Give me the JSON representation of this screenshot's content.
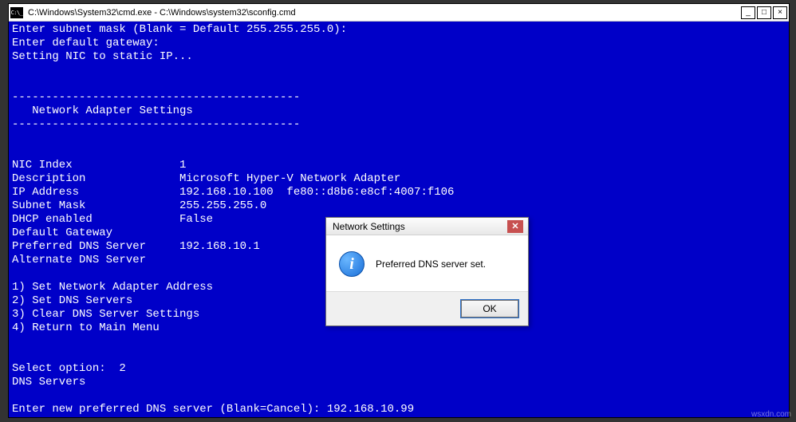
{
  "window": {
    "title": "C:\\Windows\\System32\\cmd.exe - C:\\Windows\\system32\\sconfig.cmd",
    "icon_label": "C:\\_",
    "min_label": "_",
    "max_label": "□",
    "close_label": "×"
  },
  "console": {
    "prompt_subnet": "Enter subnet mask (Blank = Default 255.255.255.0):",
    "prompt_gateway": "Enter default gateway:",
    "status_setting": "Setting NIC to static IP...",
    "rule": "-------------------------------------------",
    "section_title": "   Network Adapter Settings",
    "fields": {
      "nic_index": {
        "label": "NIC Index",
        "value": "1"
      },
      "description": {
        "label": "Description",
        "value": "Microsoft Hyper-V Network Adapter"
      },
      "ip_address": {
        "label": "IP Address",
        "value": "192.168.10.100  fe80::d8b6:e8cf:4007:f106"
      },
      "subnet_mask": {
        "label": "Subnet Mask",
        "value": "255.255.255.0"
      },
      "dhcp": {
        "label": "DHCP enabled",
        "value": "False"
      },
      "gateway": {
        "label": "Default Gateway",
        "value": ""
      },
      "pref_dns": {
        "label": "Preferred DNS Server",
        "value": "192.168.10.1"
      },
      "alt_dns": {
        "label": "Alternate DNS Server",
        "value": ""
      }
    },
    "menu": {
      "item1": "1) Set Network Adapter Address",
      "item2": "2) Set DNS Servers",
      "item3": "3) Clear DNS Server Settings",
      "item4": "4) Return to Main Menu"
    },
    "select_label": "Select option:  ",
    "select_value": "2",
    "dns_heading": "DNS Servers",
    "prompt_newdns_label": "Enter new preferred DNS server (Blank=Cancel): ",
    "prompt_newdns_value": "192.168.10.99"
  },
  "dialog": {
    "title": "Network Settings",
    "close_label": "✕",
    "icon_glyph": "i",
    "message": "Preferred DNS server set.",
    "ok_label": "OK"
  },
  "watermark": "wsxdn.com"
}
